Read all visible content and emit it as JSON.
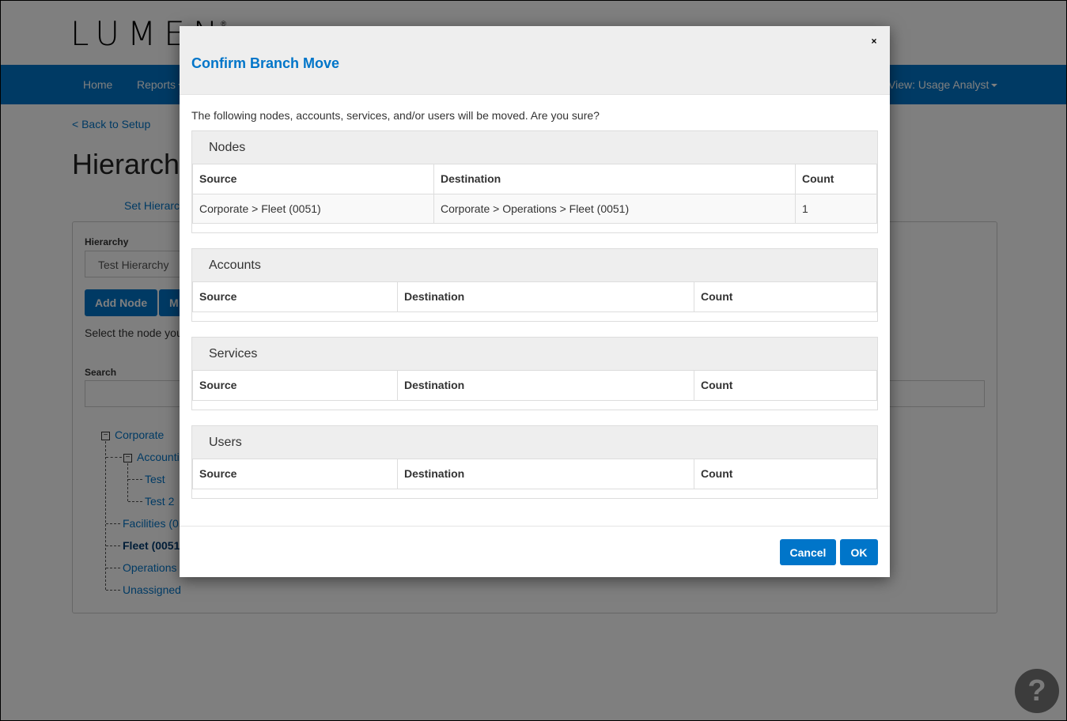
{
  "brand": {
    "logo_text": "LUMEN",
    "registered": "®"
  },
  "navbar": {
    "items": [
      {
        "label": "Home",
        "dropdown": false
      },
      {
        "label": "Reports",
        "dropdown": true
      }
    ],
    "view_label": "View: Usage Analyst"
  },
  "page": {
    "back_link": "< Back to Setup",
    "title": "Hierarchy",
    "set_hierarchy_link": "Set Hierarchy",
    "hierarchy_label": "Hierarchy",
    "hierarchy_value": "Test Hierarchy",
    "add_node_button": "Add Node",
    "second_button": "M",
    "helper_text": "Select the node you",
    "search_label": "Search",
    "search_value": "",
    "tree": [
      {
        "label": "Corporate",
        "level": 0,
        "expanded": true,
        "bold": false
      },
      {
        "label": "Accounting",
        "level": 1,
        "expanded": true,
        "bold": false
      },
      {
        "label": "Test",
        "level": 2,
        "bold": false
      },
      {
        "label": "Test 2",
        "level": 2,
        "bold": false
      },
      {
        "label": "Facilities (0",
        "level": 1,
        "bold": false
      },
      {
        "label": "Fleet (0051",
        "level": 1,
        "bold": true
      },
      {
        "label": "Operations",
        "level": 1,
        "bold": false
      },
      {
        "label": "Unassigned",
        "level": 1,
        "bold": false
      }
    ]
  },
  "modal": {
    "title": "Confirm Branch Move",
    "close_label": "×",
    "message": "The following nodes, accounts, services, and/or users will be moved. Are you sure?",
    "sections": [
      {
        "title": "Nodes",
        "columns": [
          "Source",
          "Destination",
          "Count"
        ],
        "rows": [
          [
            "Corporate > Fleet (0051)",
            "Corporate > Operations > Fleet (0051)",
            "1"
          ]
        ]
      },
      {
        "title": "Accounts",
        "columns": [
          "Source",
          "Destination",
          "Count"
        ],
        "rows": []
      },
      {
        "title": "Services",
        "columns": [
          "Source",
          "Destination",
          "Count"
        ],
        "rows": []
      },
      {
        "title": "Users",
        "columns": [
          "Source",
          "Destination",
          "Count"
        ],
        "rows": []
      }
    ],
    "cancel_label": "Cancel",
    "ok_label": "OK"
  },
  "help_button": "?",
  "colors": {
    "brand_blue": "#0075c9",
    "header_gray": "#eeeeee",
    "help_dark": "#3c3c3c"
  }
}
